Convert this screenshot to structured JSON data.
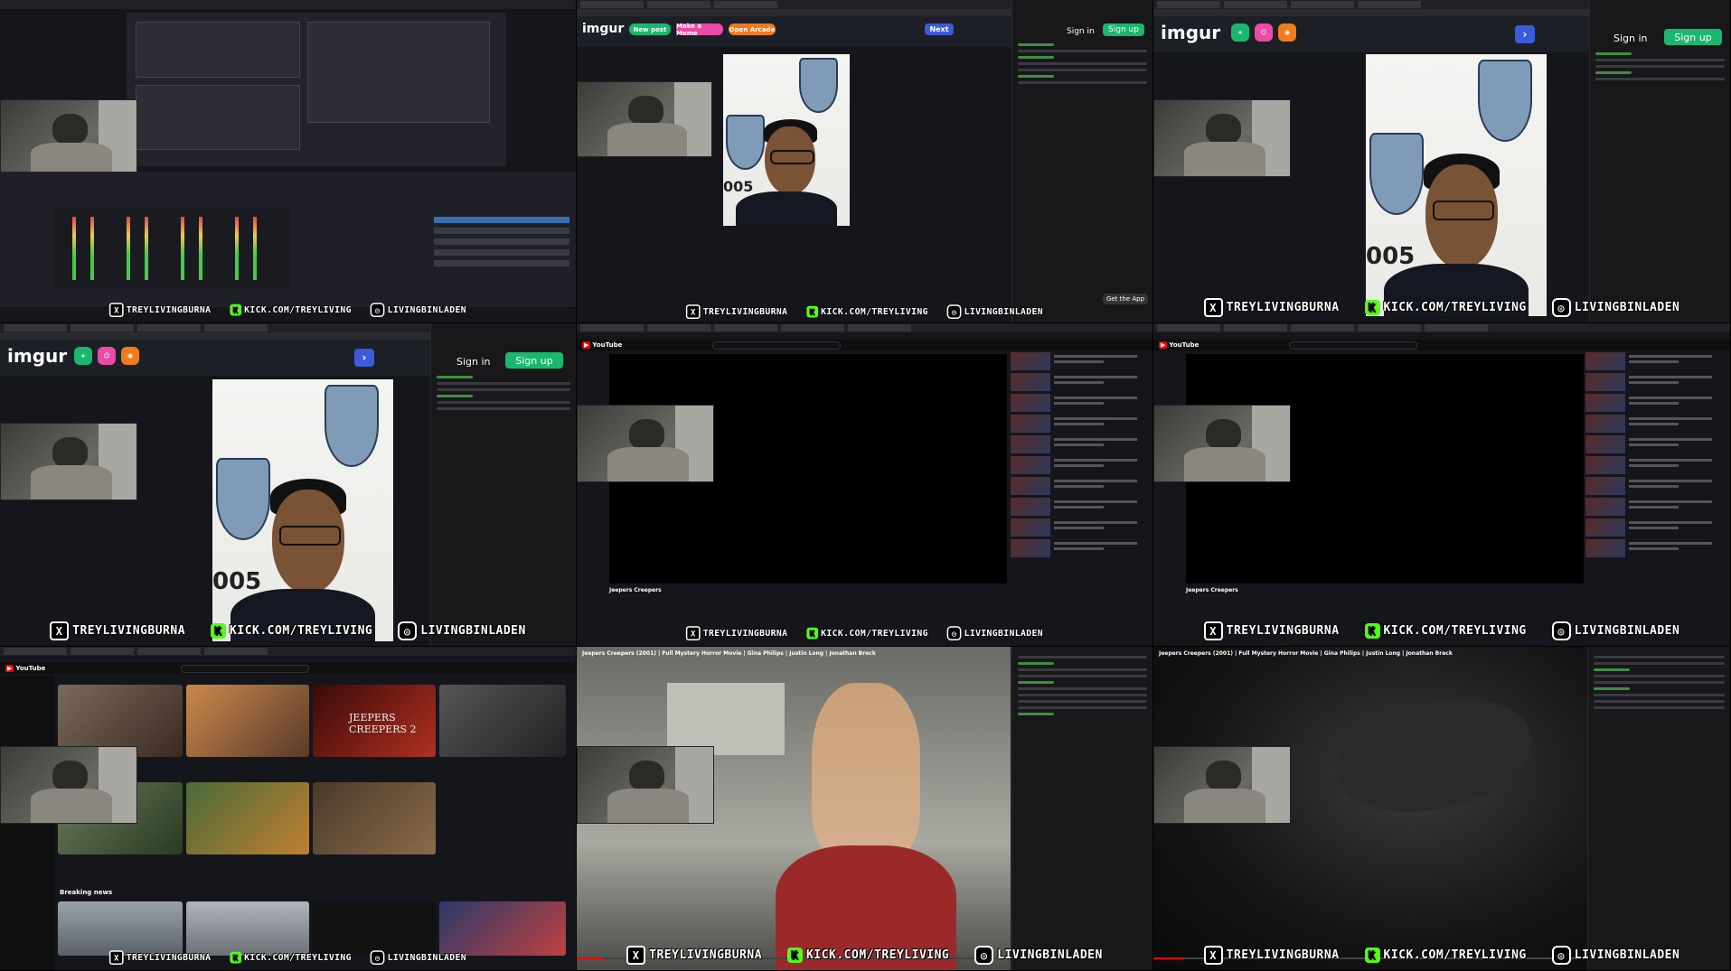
{
  "overlay": {
    "x_handle": "TREYLIVINGBURNA",
    "kick_url": "KICK.COM/TREYLIVING",
    "ig_handle": "LIVINGBINLADEN"
  },
  "imgur": {
    "logo": "imgur",
    "new_post": "New post",
    "make_meme": "Make a Meme",
    "open_arcade": "Open Arcade",
    "next": "Next",
    "sign_in": "Sign in",
    "sign_up": "Sign up",
    "get_app": "Get the App",
    "photo_number": "005"
  },
  "youtube": {
    "logo": "YouTube",
    "movie_title": "Jeepers Creepers (2001) | Full Mystery Horror Movie | Gina Philips | Justin Long | Jonathan Breck",
    "video_title": "Jeepers Creepers",
    "home_thumb_text": "JEEPERS CREEPERS 2",
    "breaking_news": "Breaking news"
  },
  "colors": {
    "kick_green": "#53fc18",
    "imgur_green": "#1bb76e",
    "youtube_red": "#ff0000",
    "obs_blue": "#3a6db0"
  }
}
